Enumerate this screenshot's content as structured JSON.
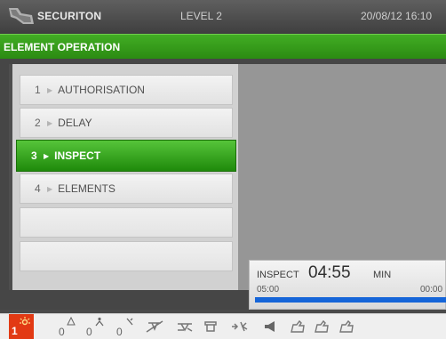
{
  "header": {
    "brand": "SECURITON",
    "level": "LEVEL 2",
    "datetime": "20/08/12 16:10"
  },
  "title": "ELEMENT OPERATION",
  "menu": {
    "items": [
      {
        "num": "1",
        "label": "AUTHORISATION",
        "active": false
      },
      {
        "num": "2",
        "label": "DELAY",
        "active": false
      },
      {
        "num": "3",
        "label": "INSPECT",
        "active": true
      },
      {
        "num": "4",
        "label": "ELEMENTS",
        "active": false
      }
    ]
  },
  "timer": {
    "label": "INSPECT",
    "value": "04:55",
    "unit": "MIN",
    "start": "05:00",
    "end": "00:00",
    "progress": 1.0,
    "bar_color": "#1565d8"
  },
  "status": {
    "alarm_count": "1",
    "fault_count": "0",
    "warning_count": "0",
    "disable_count": "0",
    "alarm_color": "#e23a14"
  },
  "colors": {
    "accent_green": "#2b8b12",
    "topbar": "#4f4f4f"
  }
}
